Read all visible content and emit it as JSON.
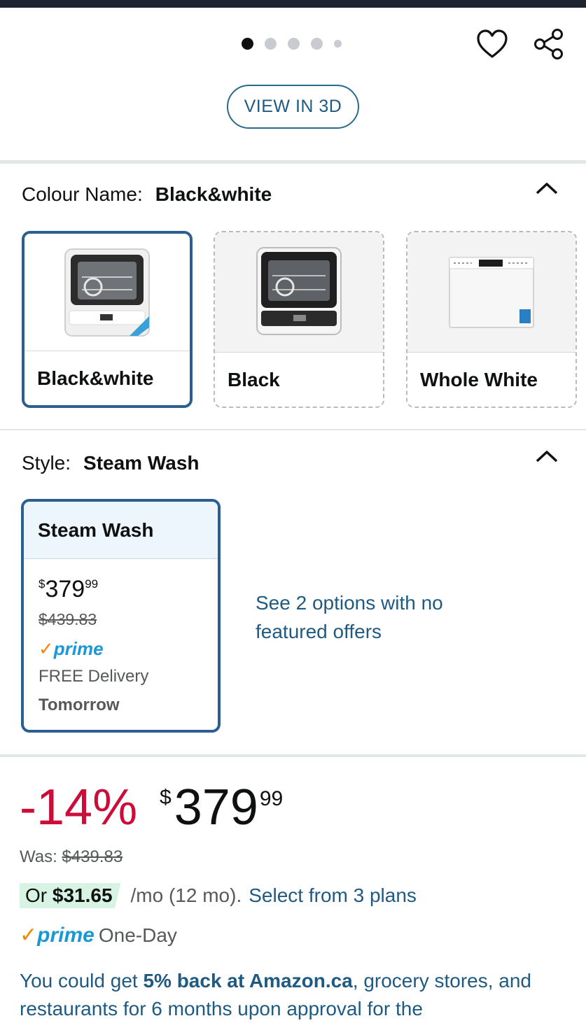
{
  "gallery": {
    "view_3d_label": "VIEW IN 3D",
    "dots": 5,
    "active_dot": 0
  },
  "colour": {
    "label": "Colour Name:",
    "selected": "Black&white",
    "options": [
      {
        "name": "Black&white",
        "selected": true
      },
      {
        "name": "Black",
        "selected": false
      },
      {
        "name": "Whole White",
        "selected": false
      }
    ]
  },
  "style": {
    "label": "Style:",
    "selected": "Steam Wash",
    "card": {
      "title": "Steam Wash",
      "currency": "$",
      "price_whole": "379",
      "price_cents": "99",
      "was": "$439.83",
      "prime_check": "✓",
      "prime_word": "prime",
      "delivery": "FREE Delivery",
      "delivery_day": "Tomorrow"
    },
    "more_options": "See 2 options with no featured offers"
  },
  "pricing": {
    "discount": "-14%",
    "currency": "$",
    "price_whole": "379",
    "price_cents": "99",
    "was_label": "Was:",
    "was_value": "$439.83",
    "installment_prefix": "Or",
    "installment_amount": "$31.65",
    "installment_term": "/mo (12 mo).",
    "installment_link": "Select from 3 plans",
    "prime_check": "✓",
    "prime_word": "prime",
    "prime_delivery": "One-Day",
    "cashback_pre": "You could get",
    "cashback_bold": "5% back at Amazon.ca",
    "cashback_post": ", grocery stores, and restaurants for 6 months upon approval for the"
  },
  "colors": {
    "accent_link": "#1f5a82",
    "discount_red": "#cc0c39",
    "selected_border": "#2b5f91",
    "prime_blue": "#1a98d5",
    "prime_orange": "#f08804",
    "installment_bg": "#d7f3e3"
  },
  "icons": [
    "heart-icon",
    "share-icon",
    "chevron-up-icon",
    "prime-check-icon"
  ]
}
